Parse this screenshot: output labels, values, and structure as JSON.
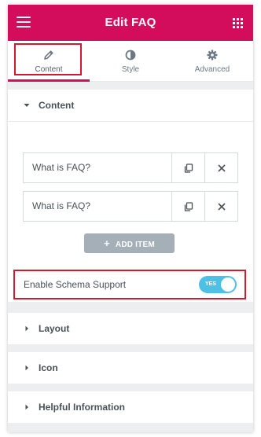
{
  "header": {
    "title": "Edit FAQ",
    "menu_icon": "hamburger-icon",
    "apps_icon": "grid-icon"
  },
  "tabs": [
    {
      "label": "Content",
      "icon": "pencil-icon",
      "active": true
    },
    {
      "label": "Style",
      "icon": "half-circle-icon",
      "active": false
    },
    {
      "label": "Advanced",
      "icon": "gear-icon",
      "active": false
    }
  ],
  "content_section": {
    "title": "Content",
    "items": [
      {
        "title": "What is FAQ?"
      },
      {
        "title": "What is FAQ?"
      }
    ],
    "add_item_label": "ADD ITEM",
    "schema": {
      "label": "Enable Schema Support",
      "toggle_text": "YES",
      "enabled": true
    }
  },
  "sections": [
    {
      "title": "Layout"
    },
    {
      "title": "Icon"
    },
    {
      "title": "Helpful Information"
    }
  ],
  "colors": {
    "brand": "#d30c5c",
    "toggle_on": "#4ec0e4",
    "highlight": "#d3192c",
    "button": "#a4afb7"
  }
}
